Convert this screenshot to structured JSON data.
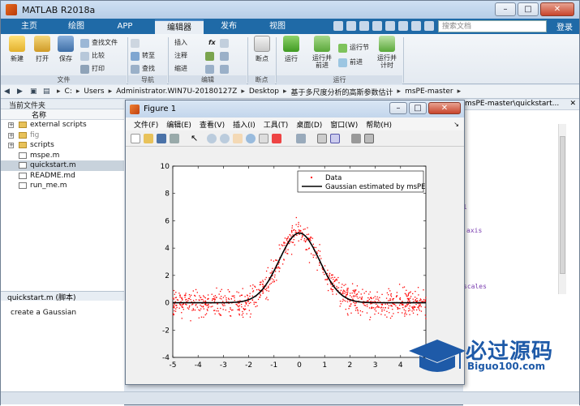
{
  "app": {
    "title": "MATLAB R2018a"
  },
  "window_controls": {
    "min": "–",
    "max": "□",
    "close": "✕"
  },
  "tabs": [
    "主页",
    "绘图",
    "APP",
    "编辑器",
    "发布",
    "视图"
  ],
  "active_tab": "编辑器",
  "search": {
    "placeholder": "搜索文档"
  },
  "login": "登录",
  "ribbon": {
    "file": {
      "new": "新建",
      "open": "打开",
      "save": "保存",
      "find_file": "查找文件",
      "compare": "比较",
      "print": "打印",
      "label": "文件"
    },
    "nav": {
      "goto": "转至",
      "find": "查找",
      "label": "导航"
    },
    "edit": {
      "insert": "插入",
      "comment": "注释",
      "indent": "缩进",
      "label": "编辑"
    },
    "breakpoints": {
      "bp": "断点",
      "label": "断点"
    },
    "run": {
      "run": "运行",
      "run_advance": "运行并\n前进",
      "run_section": "运行节",
      "advance": "前进",
      "run_time": "运行并\n计时",
      "label": "运行"
    }
  },
  "address": {
    "crumbs": [
      "C:",
      "Users",
      "Administrator.WIN7U-20180127Z",
      "Desktop",
      "基于多尺度分析的高斯参数估计",
      "msPE-master"
    ]
  },
  "current_folder": {
    "title": "当前文件夹",
    "column": "名称",
    "files": [
      {
        "name": "external scripts",
        "type": "folder"
      },
      {
        "name": "fig",
        "type": "folder"
      },
      {
        "name": "scripts",
        "type": "folder"
      },
      {
        "name": "mspe.m",
        "type": "m"
      },
      {
        "name": "quickstart.m",
        "type": "m"
      },
      {
        "name": "README.md",
        "type": "md"
      },
      {
        "name": "run_me.m",
        "type": "m"
      }
    ],
    "selected": "quickstart.m"
  },
  "details": {
    "title": "quickstart.m  (脚本)",
    "body": "create a Gaussian"
  },
  "editor": {
    "path": "msPE-master\\quickstart...",
    "code_fragments": [
      "l",
      "axis",
      "scales"
    ]
  },
  "figure": {
    "title": "Figure 1",
    "menu": [
      "文件(F)",
      "编辑(E)",
      "查看(V)",
      "插入(I)",
      "工具(T)",
      "桌面(D)",
      "窗口(W)",
      "帮助(H)"
    ]
  },
  "watermark": {
    "text": "必过源码",
    "sub": "Biguo100.com"
  },
  "chart_data": {
    "type": "scatter",
    "title": "",
    "xlabel": "",
    "ylabel": "",
    "xlim": [
      -5,
      5
    ],
    "ylim": [
      -4,
      10
    ],
    "xticks": [
      -5,
      -4,
      -3,
      -2,
      -1,
      0,
      1,
      2,
      3,
      4
    ],
    "yticks": [
      -4,
      -2,
      0,
      2,
      4,
      6,
      8,
      10
    ],
    "legend_position": "top-right",
    "series": [
      {
        "name": "Data",
        "type": "scatter",
        "color": "#ff0000",
        "model": {
          "amplitude": 5.1,
          "mean": 0,
          "sigma": 0.8,
          "noise_sd": 0.9,
          "n": 900
        }
      },
      {
        "name": "Gaussian estimated by msPE",
        "type": "line",
        "color": "#000000",
        "model": {
          "amplitude": 5.1,
          "mean": 0,
          "sigma": 0.8
        }
      }
    ]
  }
}
